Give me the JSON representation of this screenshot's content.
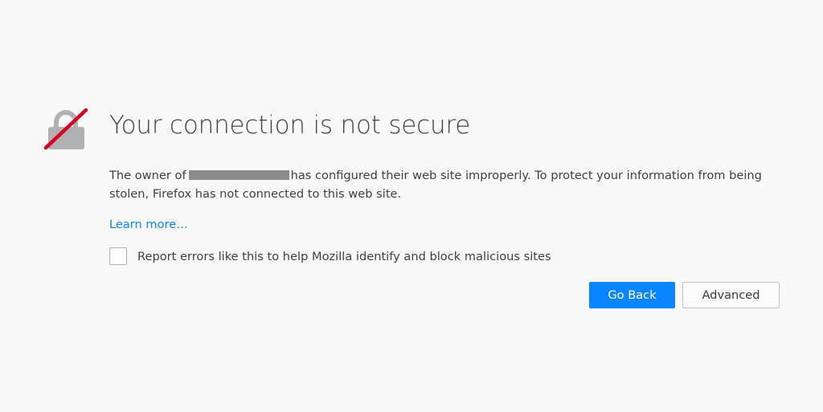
{
  "error": {
    "title": "Your connection is not secure",
    "description": {
      "prefix": "The owner of",
      "suffix": "has configured their web site improperly. To protect your information from being stolen, Firefox has not connected to this web site."
    },
    "learn_more": "Learn more…",
    "report_checkbox": {
      "label": "Report errors like this to help Mozilla identify and block malicious sites",
      "checked": false
    },
    "buttons": {
      "go_back": "Go Back",
      "advanced": "Advanced"
    }
  },
  "icons": {
    "lock": "broken-lock-icon"
  },
  "colors": {
    "background": "#f9f9fa",
    "accent": "#0a84ff",
    "slash": "#d70022",
    "lock": "#b1b1b3",
    "redaction": "#8c8c8c"
  }
}
